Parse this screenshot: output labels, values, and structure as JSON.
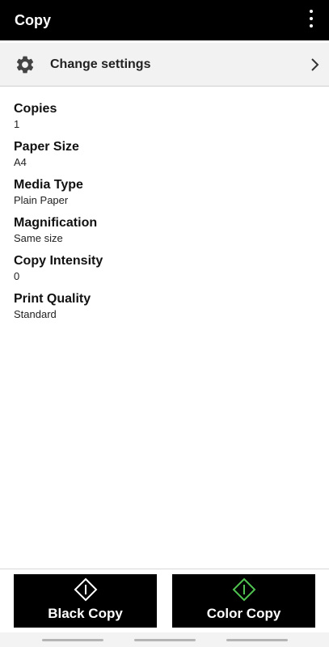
{
  "header": {
    "title": "Copy",
    "menu_icon": "more-vert-icon"
  },
  "settings_row": {
    "label": "Change settings",
    "icon": "gear-icon",
    "chevron": "chevron-right-icon"
  },
  "settings": [
    {
      "name": "Copies",
      "value": "1"
    },
    {
      "name": "Paper Size",
      "value": "A4"
    },
    {
      "name": "Media Type",
      "value": "Plain Paper"
    },
    {
      "name": "Magnification",
      "value": "Same size"
    },
    {
      "name": "Copy Intensity",
      "value": "0"
    },
    {
      "name": "Print Quality",
      "value": "Standard"
    }
  ],
  "buttons": {
    "black": {
      "label": "Black Copy",
      "icon": "start-icon",
      "icon_color": "#ffffff"
    },
    "color": {
      "label": "Color Copy",
      "icon": "start-icon",
      "icon_color": "#4fc24f"
    }
  },
  "colors": {
    "appbar": "#000000",
    "button": "#000000",
    "accent_green": "#4fc24f"
  }
}
